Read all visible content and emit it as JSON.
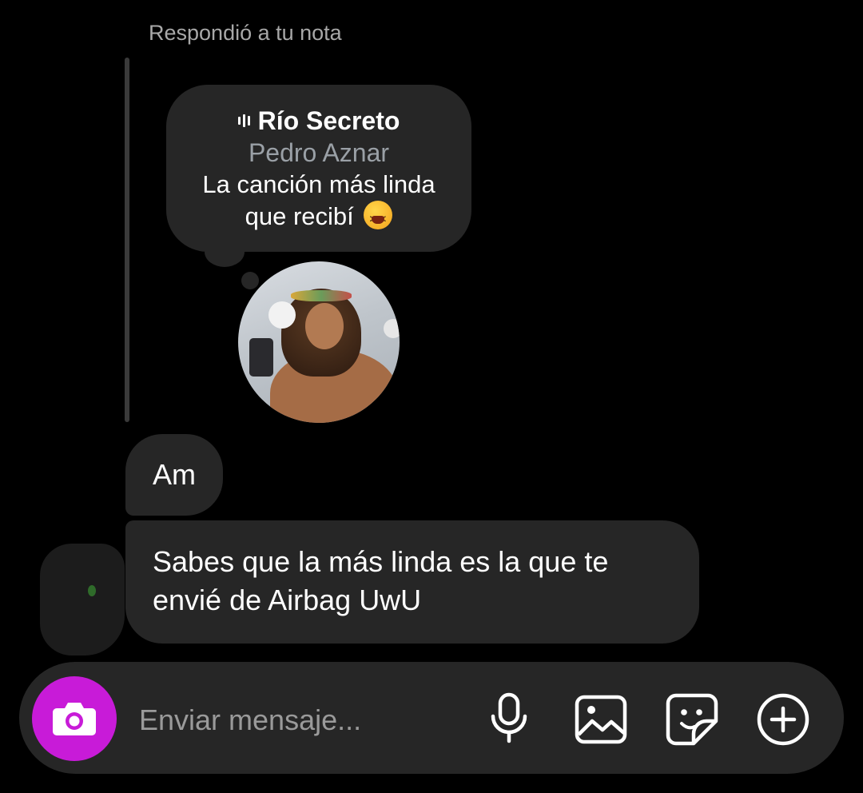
{
  "reply": {
    "label": "Respondió a tu nota"
  },
  "note": {
    "song_title": "Río Secreto",
    "artist": "Pedro Aznar",
    "text": "La canción más linda que recibí",
    "emoji": "tired-face-emoji"
  },
  "avatar": {
    "icon": "profile-photo"
  },
  "messages": [
    {
      "text": "Am"
    },
    {
      "text": "Sabes que la más linda es la que te envié de Airbag UwU"
    }
  ],
  "composer": {
    "placeholder": "Enviar mensaje...",
    "icons": [
      "camera-icon",
      "microphone-icon",
      "gallery-icon",
      "sticker-icon",
      "plus-icon"
    ],
    "camera_color": "#c81bd8"
  },
  "colors": {
    "background": "#000000",
    "bubble": "#262626",
    "secondary_text": "#a8a8a8"
  }
}
